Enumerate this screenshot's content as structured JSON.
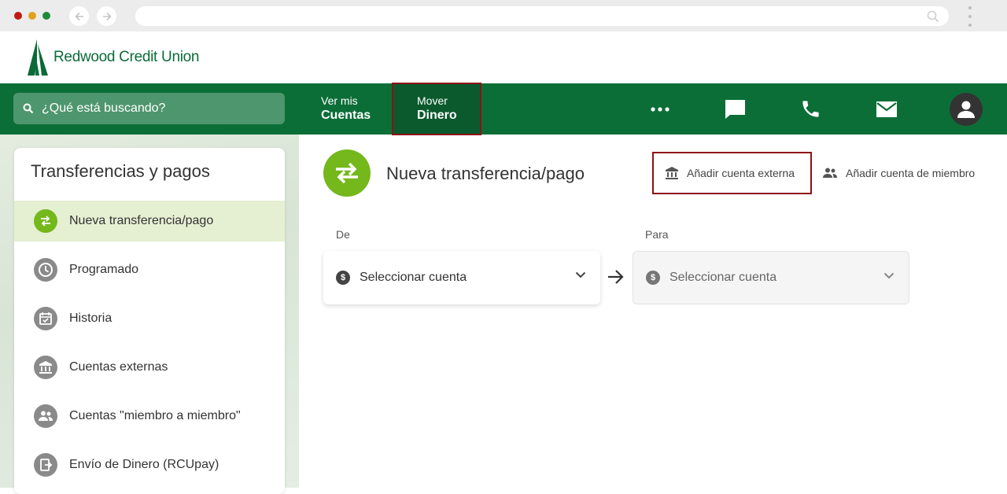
{
  "browser": {
    "back_icon": "arrow-left-icon",
    "forward_icon": "arrow-right-icon",
    "url": ""
  },
  "brand": {
    "name": "Redwood Credit Union",
    "color": "#0a6b38"
  },
  "topnav": {
    "search_placeholder": "¿Qué está buscando?",
    "links": [
      {
        "top": "Ver mis",
        "bottom": "Cuentas"
      },
      {
        "top": "Mover",
        "bottom": "Dinero",
        "active": true
      }
    ],
    "icons": [
      "more-icon",
      "chat-icon",
      "phone-icon",
      "mail-icon",
      "account-icon"
    ],
    "bg_color": "#0b6e37"
  },
  "sidebar": {
    "title": "Transferencias y pagos",
    "items": [
      {
        "label": "Nueva transferencia/pago",
        "icon": "swap-icon",
        "active": true
      },
      {
        "label": "Programado",
        "icon": "clock-icon"
      },
      {
        "label": "Historia",
        "icon": "calendar-check-icon"
      },
      {
        "label": "Cuentas externas",
        "icon": "bank-icon"
      },
      {
        "label": "Cuentas \"miembro a miembro\"",
        "icon": "people-icon"
      },
      {
        "label": "Envío de Dinero (RCUpay)",
        "icon": "send-money-icon"
      }
    ]
  },
  "main": {
    "title": "Nueva transferencia/pago",
    "actions": {
      "add_external": "Añadir cuenta externa",
      "add_member": "Añadir cuenta de miembro"
    },
    "from": {
      "label": "De",
      "placeholder": "Seleccionar cuenta"
    },
    "to": {
      "label": "Para",
      "placeholder": "Seleccionar cuenta"
    },
    "accent_color": "#74b81c",
    "highlight_color": "#8e1116"
  }
}
